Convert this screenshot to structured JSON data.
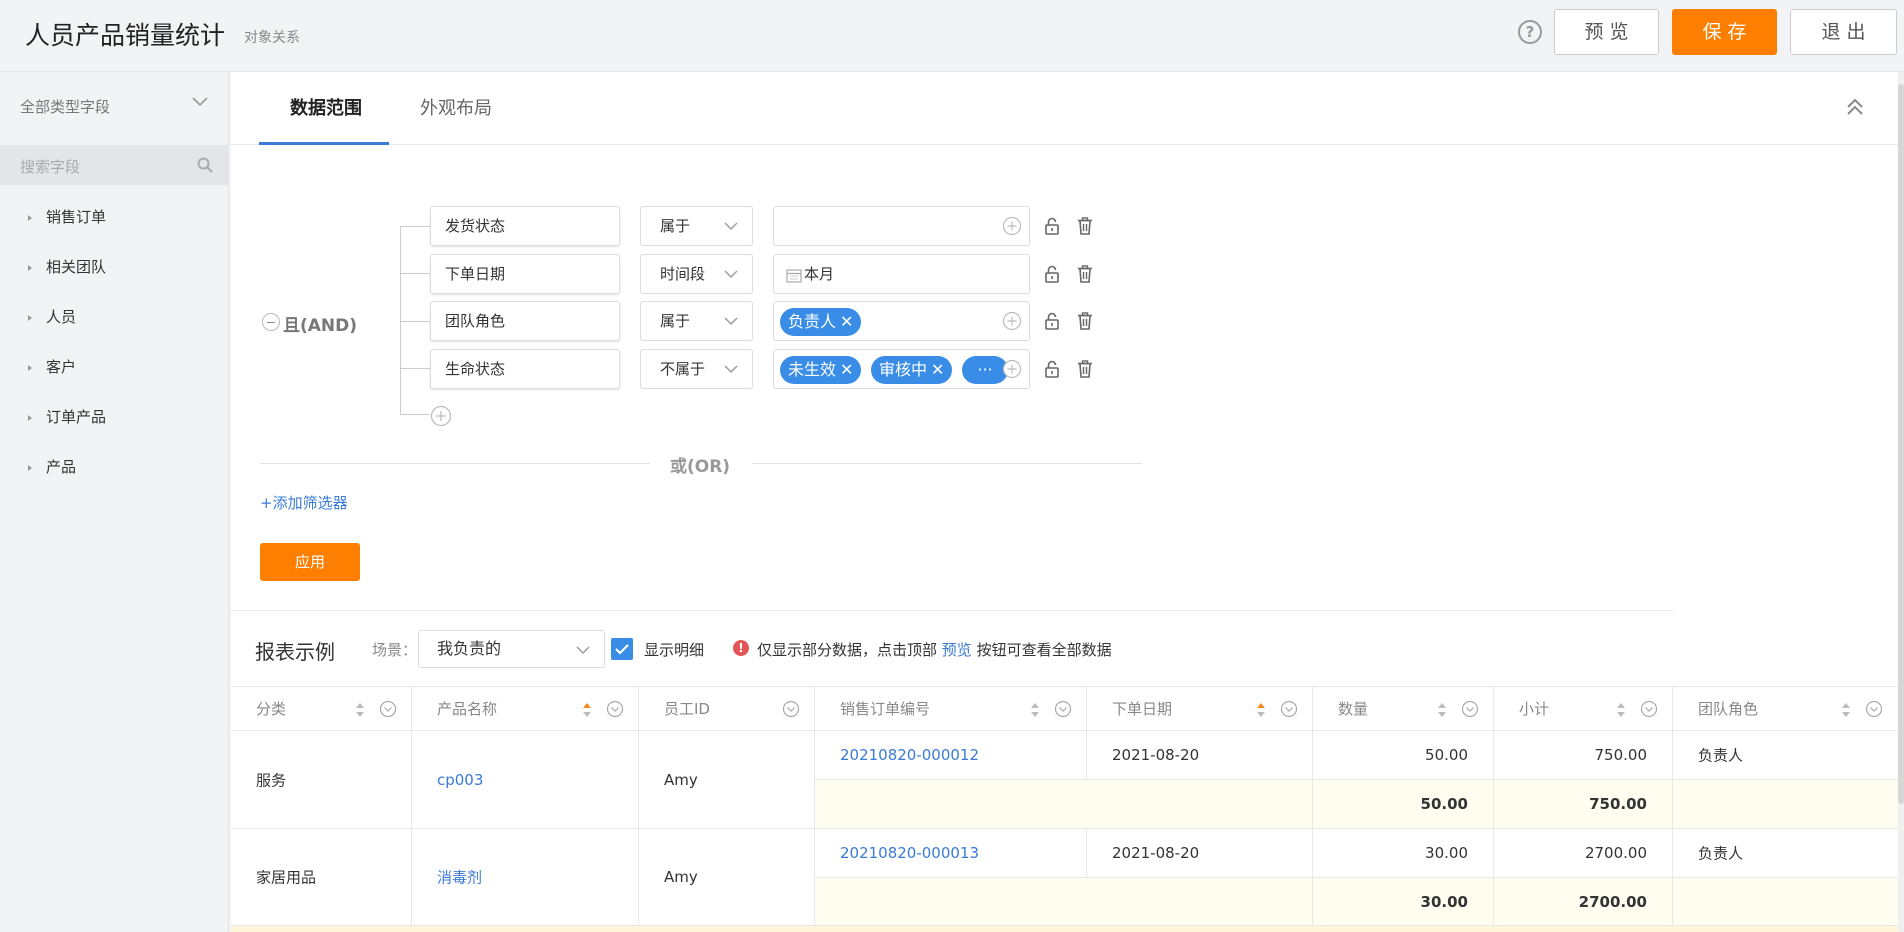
{
  "header": {
    "title": "人员产品销量统计",
    "subtitle": "对象关系",
    "help": "?",
    "preview_label": "预 览",
    "save_label": "保 存",
    "exit_label": "退 出"
  },
  "sidebar": {
    "type_filter": "全部类型字段",
    "search_placeholder": "搜索字段",
    "items": [
      {
        "label": "销售订单"
      },
      {
        "label": "相关团队"
      },
      {
        "label": "人员"
      },
      {
        "label": "客户"
      },
      {
        "label": "订单产品"
      },
      {
        "label": "产品"
      }
    ]
  },
  "tabs": [
    {
      "label": "数据范围",
      "active": true
    },
    {
      "label": "外观布局",
      "active": false
    }
  ],
  "filter": {
    "group_label": "且(AND)",
    "conditions": [
      {
        "field": "发货状态",
        "operator": "属于",
        "value_text": "",
        "tags": []
      },
      {
        "field": "下单日期",
        "operator": "时间段",
        "value_text": "本月",
        "tags": []
      },
      {
        "field": "团队角色",
        "operator": "属于",
        "value_text": "",
        "tags": [
          "负责人"
        ]
      },
      {
        "field": "生命状态",
        "operator": "不属于",
        "value_text": "",
        "tags": [
          "未生效",
          "审核中",
          "···"
        ]
      }
    ],
    "or_label": "或(OR)",
    "add_filter_label": "+添加筛选器",
    "apply_label": "应用"
  },
  "report": {
    "title": "报表示例",
    "scene_label": "场景：",
    "scene_value": "我负责的",
    "show_detail_label": "显示明细",
    "show_detail_checked": true,
    "note_prefix": "仅显示部分数据，点击顶部",
    "note_link": "预览",
    "note_suffix": "按钮可查看全部数据"
  },
  "table": {
    "columns": [
      "分类",
      "产品名称",
      "员工ID",
      "销售订单编号",
      "下单日期",
      "数量",
      "小计",
      "团队角色"
    ],
    "groups": [
      {
        "category": "服务",
        "product": "cp003",
        "employee": "Amy",
        "order_no": "20210820-000012",
        "date": "2021-08-20",
        "qty": "50.00",
        "subtotal": "750.00",
        "role": "负责人",
        "sum_qty": "50.00",
        "sum_subtotal": "750.00"
      },
      {
        "category": "家居用品",
        "product": "消毒剂",
        "employee": "Amy",
        "order_no": "20210820-000013",
        "date": "2021-08-20",
        "qty": "30.00",
        "subtotal": "2700.00",
        "role": "负责人",
        "sum_qty": "30.00",
        "sum_subtotal": "2700.00"
      }
    ]
  },
  "colors": {
    "accent": "#fe7e00",
    "link": "#3a7bd5",
    "tag": "#3a8de6"
  }
}
